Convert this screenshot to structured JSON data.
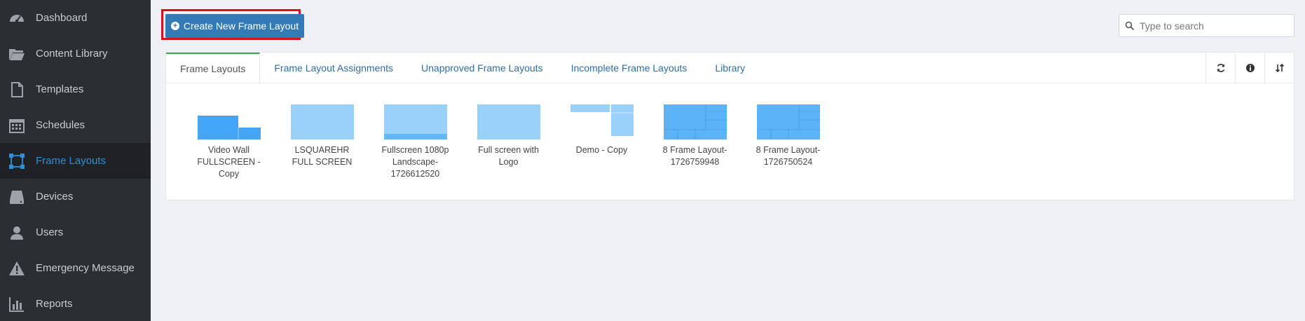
{
  "sidebar": {
    "items": [
      {
        "label": "Dashboard",
        "icon": "dashboard-icon"
      },
      {
        "label": "Content Library",
        "icon": "folder-open-icon"
      },
      {
        "label": "Templates",
        "icon": "file-icon"
      },
      {
        "label": "Schedules",
        "icon": "calendar-icon"
      },
      {
        "label": "Frame Layouts",
        "icon": "frame-layout-icon",
        "active": true
      },
      {
        "label": "Devices",
        "icon": "hard-drive-icon"
      },
      {
        "label": "Users",
        "icon": "user-icon"
      },
      {
        "label": "Emergency Message",
        "icon": "warning-icon"
      },
      {
        "label": "Reports",
        "icon": "bar-chart-icon"
      }
    ]
  },
  "toolbar": {
    "create_label": "Create New Frame Layout",
    "search_placeholder": "Type to search"
  },
  "tabs": [
    {
      "label": "Frame Layouts",
      "active": true
    },
    {
      "label": "Frame Layout Assignments"
    },
    {
      "label": "Unapproved Frame Layouts"
    },
    {
      "label": "Incomplete Frame Layouts"
    },
    {
      "label": "Library"
    }
  ],
  "tools": [
    "refresh-icon",
    "info-icon",
    "sort-icon"
  ],
  "layouts": [
    {
      "name": "Video Wall FULLSCREEN - Copy"
    },
    {
      "name": "LSQUAREHR FULL SCREEN"
    },
    {
      "name": "Fullscreen 1080p Landscape-1726612520"
    },
    {
      "name": "Full screen with Logo"
    },
    {
      "name": "Demo - Copy"
    },
    {
      "name": "8 Frame Layout-1726759948"
    },
    {
      "name": "8 Frame Layout-1726750524"
    }
  ],
  "colors": {
    "sidebar_bg": "#2b2e33",
    "accent": "#2e8fd4",
    "button": "#337ab7",
    "highlight": "#d8121c",
    "thumb_light": "#99d1fb",
    "thumb_dark": "#42a5f5"
  }
}
